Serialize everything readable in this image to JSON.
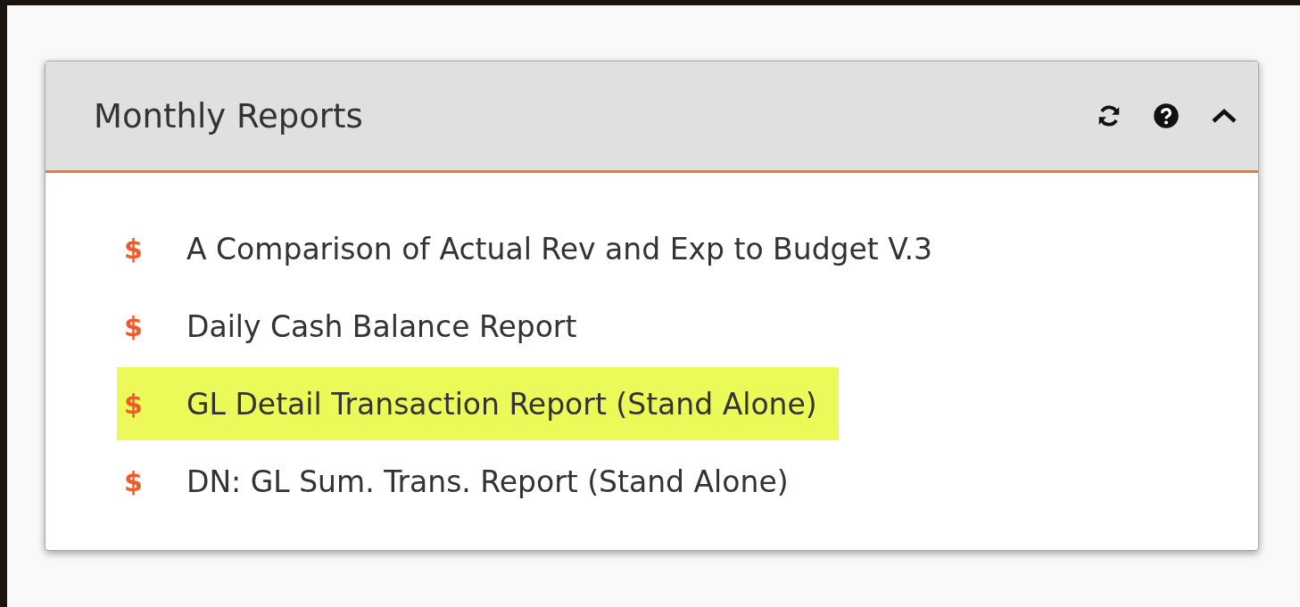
{
  "panel": {
    "title": "Monthly Reports",
    "expanded": true,
    "items": [
      {
        "icon": "$",
        "label": "A Comparison of Actual Rev and Exp to Budget V.3",
        "highlighted": false
      },
      {
        "icon": "$",
        "label": "Daily Cash Balance Report",
        "highlighted": false
      },
      {
        "icon": "$",
        "label": "GL Detail Transaction Report (Stand Alone)",
        "highlighted": true
      },
      {
        "icon": "$",
        "label": "DN: GL Sum. Trans. Report (Stand Alone)",
        "highlighted": false
      }
    ]
  }
}
